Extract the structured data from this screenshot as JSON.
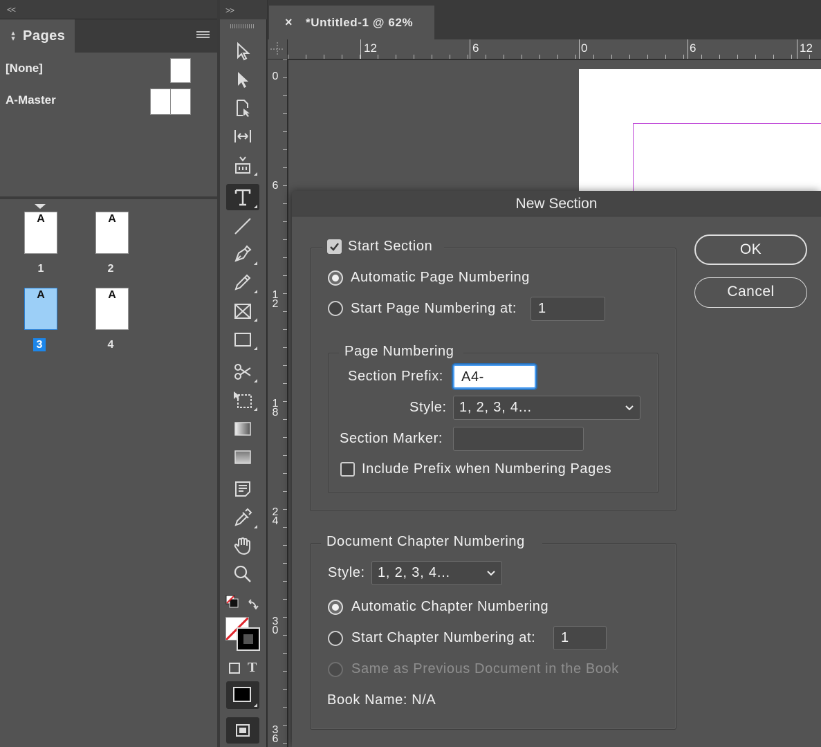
{
  "pages_panel": {
    "collapse": "<<",
    "tab_label": "Pages",
    "masters": [
      {
        "label": "[None]"
      },
      {
        "label": "A-Master"
      }
    ],
    "pages": [
      {
        "number": "1",
        "master": "A",
        "selected": false
      },
      {
        "number": "2",
        "master": "A",
        "selected": false
      },
      {
        "number": "3",
        "master": "A",
        "selected": true
      },
      {
        "number": "4",
        "master": "A",
        "selected": false
      }
    ]
  },
  "tools_panel": {
    "collapse": ">>",
    "tools": [
      "selection-tool",
      "direct-selection-tool",
      "page-tool",
      "gap-tool",
      "content-collector-tool",
      "type-tool",
      "line-tool",
      "pen-tool",
      "pencil-tool",
      "rectangle-frame-tool",
      "rectangle-tool",
      "scissors-tool",
      "free-transform-tool",
      "gradient-swatch-tool",
      "gradient-feather-tool",
      "note-tool",
      "eyedropper-tool",
      "hand-tool",
      "zoom-tool"
    ],
    "active_tool": "type-tool",
    "format_text_glyph": "T"
  },
  "document": {
    "close_glyph": "×",
    "tab_title": "*Untitled-1 @ 62%",
    "ruler_h_labels": [
      "12",
      "6",
      "0",
      "6",
      "12"
    ],
    "ruler_v_labels": [
      "0",
      "6",
      "1 2",
      "1 8",
      "2 4",
      "3 0",
      "3 6"
    ],
    "margin_color": "#c04ad8"
  },
  "dialog": {
    "title": "New Section",
    "start_section": {
      "label": "Start Section",
      "checked": true
    },
    "auto_page_numbering": {
      "label": "Automatic Page Numbering",
      "selected": true
    },
    "start_page_numbering": {
      "label": "Start Page Numbering at:",
      "value": "1",
      "selected": false
    },
    "page_numbering": {
      "legend": "Page Numbering",
      "section_prefix_label": "Section Prefix:",
      "section_prefix_value": "A4-",
      "style_label": "Style:",
      "style_value": "1, 2, 3, 4...",
      "section_marker_label": "Section Marker:",
      "section_marker_value": "",
      "include_prefix": {
        "label": "Include Prefix when Numbering Pages",
        "checked": false
      }
    },
    "chapter_numbering": {
      "legend": "Document Chapter Numbering",
      "style_label": "Style:",
      "style_value": "1, 2, 3, 4...",
      "auto_chapter": {
        "label": "Automatic Chapter Numbering",
        "selected": true
      },
      "start_chapter": {
        "label": "Start Chapter Numbering at:",
        "value": "1",
        "selected": false
      },
      "same_as_previous": {
        "label": "Same as Previous Document in the Book",
        "enabled": false
      },
      "book_name": "Book Name: N/A"
    },
    "ok_label": "OK",
    "cancel_label": "Cancel"
  },
  "colors": {
    "accent": "#1c86ea",
    "selected_page": "#9ccff7"
  }
}
